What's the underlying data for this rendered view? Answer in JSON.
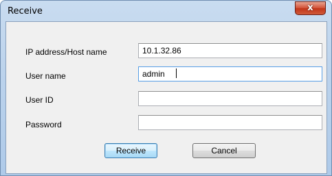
{
  "window": {
    "title": "Receive",
    "close_glyph": "x"
  },
  "form": {
    "ip_label": "IP address/Host name",
    "ip_value": "10.1.32.86",
    "user_name_label": "User name",
    "user_name_value": "admin",
    "user_id_label": "User ID",
    "user_id_value": "",
    "password_label": "Password",
    "password_value": ""
  },
  "buttons": {
    "receive": "Receive",
    "cancel": "Cancel"
  },
  "icons": {
    "close": "close-icon"
  }
}
